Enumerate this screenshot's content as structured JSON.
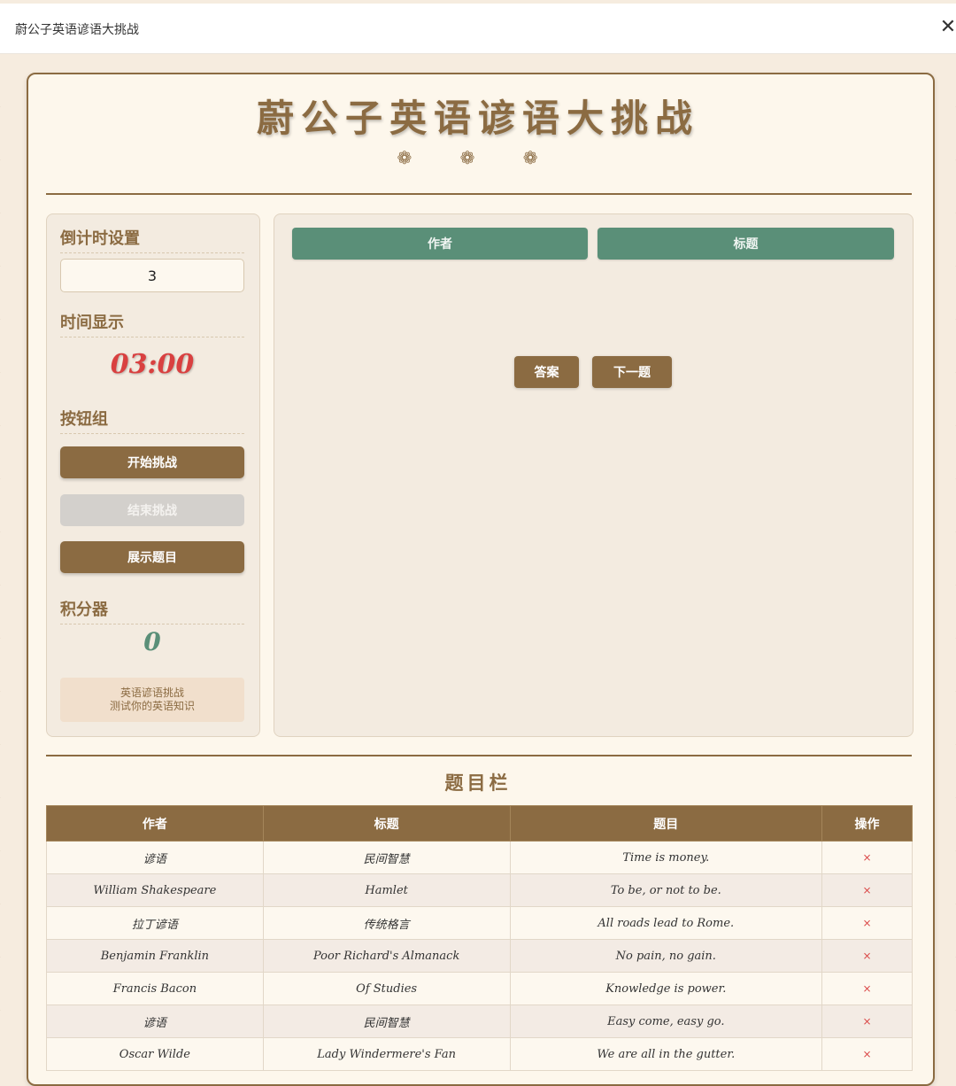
{
  "window": {
    "title": "蔚公子英语谚语大挑战"
  },
  "header": {
    "title": "蔚公子英语谚语大挑战",
    "ornaments": "❁ ❁ ❁"
  },
  "sidebar": {
    "countdown_label": "倒计时设置",
    "countdown_value": "3",
    "time_label": "时间显示",
    "time_value": "03:00",
    "buttons_label": "按钮组",
    "start_button": "开始挑战",
    "end_button": "结束挑战",
    "show_button": "展示题目",
    "score_label": "积分器",
    "score_value": "0",
    "info_line1": "英语谚语挑战",
    "info_line2": "测试你的英语知识"
  },
  "main": {
    "tab_author": "作者",
    "tab_title": "标题",
    "answer_button": "答案",
    "next_button": "下一题"
  },
  "questions": {
    "section_title": "题目栏",
    "columns": [
      "作者",
      "标题",
      "题目",
      "操作"
    ],
    "delete_symbol": "×",
    "rows": [
      {
        "author": "谚语",
        "title": "民间智慧",
        "question": "Time is money."
      },
      {
        "author": "William Shakespeare",
        "title": "Hamlet",
        "question": "To be, or not to be."
      },
      {
        "author": "拉丁谚语",
        "title": "传统格言",
        "question": "All roads lead to Rome."
      },
      {
        "author": "Benjamin Franklin",
        "title": "Poor Richard's Almanack",
        "question": "No pain, no gain."
      },
      {
        "author": "Francis Bacon",
        "title": "Of Studies",
        "question": "Knowledge is power."
      },
      {
        "author": "谚语",
        "title": "民间智慧",
        "question": "Easy come, easy go."
      },
      {
        "author": "Oscar Wilde",
        "title": "Lady Windermere's Fan",
        "question": "We are all in the gutter."
      }
    ]
  },
  "colors": {
    "brown": "#8b6b42",
    "green": "#5a8f78",
    "red": "#d94040",
    "disabled": "#d3d0cc"
  }
}
